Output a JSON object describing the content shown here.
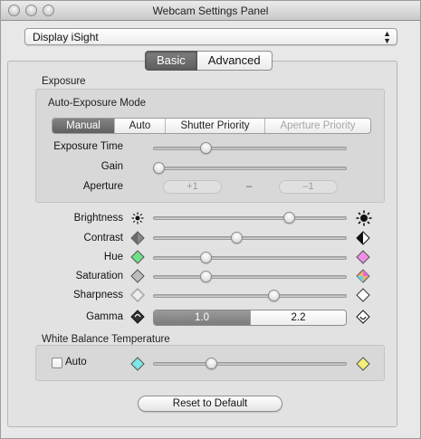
{
  "window": {
    "title": "Webcam Settings Panel"
  },
  "device": {
    "selected": "Display iSight",
    "arrows_up": "▲",
    "arrows_down": "▼"
  },
  "tabs": [
    {
      "label": "Basic",
      "active": true
    },
    {
      "label": "Advanced",
      "active": false
    }
  ],
  "exposure": {
    "section_label": "Exposure",
    "mode_label": "Auto-Exposure Mode",
    "modes": [
      {
        "label": "Manual",
        "selected": true,
        "enabled": true
      },
      {
        "label": "Auto",
        "selected": false,
        "enabled": true
      },
      {
        "label": "Shutter Priority",
        "selected": false,
        "enabled": true
      },
      {
        "label": "Aperture Priority",
        "selected": false,
        "enabled": false
      }
    ],
    "exposure_time": {
      "label": "Exposure Time",
      "level": 0.27
    },
    "gain": {
      "label": "Gain",
      "level": 0.03
    },
    "aperture": {
      "label": "Aperture",
      "plus": "+1",
      "dash": "–",
      "minus": "–1"
    }
  },
  "image": {
    "brightness": {
      "label": "Brightness",
      "level": 0.7,
      "icon_low": "sun-small-icon",
      "icon_high": "sun-large-icon"
    },
    "contrast": {
      "label": "Contrast",
      "level": 0.43,
      "icon_low": "contrast-low-icon",
      "icon_high": "contrast-high-icon"
    },
    "hue": {
      "label": "Hue",
      "level": 0.27,
      "icon_low": "hue-green-icon",
      "icon_high": "hue-pink-icon"
    },
    "saturation": {
      "label": "Saturation",
      "level": 0.27,
      "icon_low": "saturation-low-icon",
      "icon_high": "saturation-high-icon"
    },
    "sharpness": {
      "label": "Sharpness",
      "level": 0.62,
      "icon_low": "sharpness-low-icon",
      "icon_high": "sharpness-high-icon"
    },
    "gamma": {
      "label": "Gamma",
      "options": [
        "1.0",
        "2.2"
      ],
      "selected": "1.0"
    }
  },
  "white_balance": {
    "section_label": "White Balance Temperature",
    "auto_label": "Auto",
    "auto_checked": false,
    "level": 0.3,
    "icon_low": "wb-cool-icon",
    "icon_high": "wb-warm-icon"
  },
  "reset_label": "Reset to Default",
  "colors": {
    "selected_segment": "#6e6e6e",
    "hue_low": "#6fe08a",
    "hue_high": "#f08ee8",
    "wb_low": "#7ee6e6",
    "wb_high": "#f2f07a"
  }
}
